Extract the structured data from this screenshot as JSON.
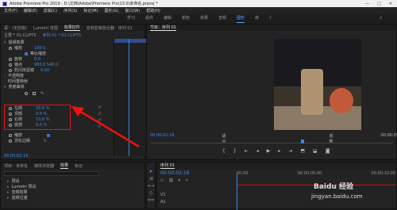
{
  "window": {
    "title": "Adobe Premiere Pro 2019 - D:\\文档\\Adobe\\Premiere Pro\\13.0\\未命名.prproj *",
    "minimize": "—",
    "maximize": "□",
    "close": "✕"
  },
  "menu": [
    "文件(F)",
    "编辑(E)",
    "剪辑(C)",
    "序列(S)",
    "标记(M)",
    "图形(G)",
    "窗口(W)",
    "帮助(H)"
  ],
  "workspaces": [
    "学习",
    "组件",
    "编辑",
    "颜色",
    "效果",
    "音频",
    "图形",
    "库",
    "》"
  ],
  "workspace_active_index": 6,
  "effect_controls": {
    "tabs": [
      "源：(无剪辑)",
      "Lumetri 范围",
      "效果控件",
      "音频剪辑混合器：序列 01"
    ],
    "active_tab_index": 2,
    "master_label": "主要 * 01.CLIPT5",
    "sequence_label": "序列 01 * 01.CLIPT5",
    "header": "视频效果",
    "rows": [
      {
        "label": "运动",
        "value": ""
      },
      {
        "label": "位置",
        "value": "640.0  360.0"
      },
      {
        "label": "缩放",
        "value": "100.0"
      },
      {
        "label": "等比缩放",
        "value": ""
      },
      {
        "label": "旋转",
        "value": "0.0"
      },
      {
        "label": "锚点",
        "value": "960.0  540.0"
      },
      {
        "label": "防闪烁滤镜",
        "value": "0.00"
      },
      {
        "label": "不透明度",
        "value": ""
      },
      {
        "label": "时间重映射",
        "value": ""
      },
      {
        "label": "亮度曲线",
        "value": ""
      }
    ],
    "highlighted": [
      {
        "label": "左侧",
        "value": "20.0 %"
      },
      {
        "label": "顶部",
        "value": "0.0 %"
      },
      {
        "label": "右侧",
        "value": "13.0 %"
      },
      {
        "label": "底部",
        "value": "0.0 %"
      }
    ],
    "after_rows": [
      {
        "label": "缩放",
        "value": ""
      },
      {
        "label": "羽化边缘",
        "value": "0"
      }
    ],
    "timecode": "00:00:02:16"
  },
  "program": {
    "tab": "节目：序列 01",
    "timecode_left": "00:00:02:16",
    "fit": "适合",
    "quality": "完整",
    "timecode_right": "00:00:05:19"
  },
  "project": {
    "tabs": [
      "项目：未命名",
      "媒体浏览器",
      "效果",
      "标记"
    ],
    "active_tab_index": 2,
    "tree": [
      "预设",
      "Lumetri 预设",
      "音频效果",
      "音频过渡"
    ]
  },
  "timeline": {
    "tab": "序列 01",
    "timecode": "00:00:02:16",
    "ruler": [
      "00:00",
      "00:00:05:00",
      "00:00:10:00"
    ],
    "tracks": [
      "V1",
      "A1",
      "A2"
    ]
  },
  "watermark": "jingyan.baidu.com",
  "watermark_brand": "Baidu 经验",
  "colors": {
    "accent_blue": "#3b8fe8",
    "highlight_red": "#e11111",
    "playhead_blue": "#2d8ceb",
    "timeline_red": "#d01010"
  }
}
